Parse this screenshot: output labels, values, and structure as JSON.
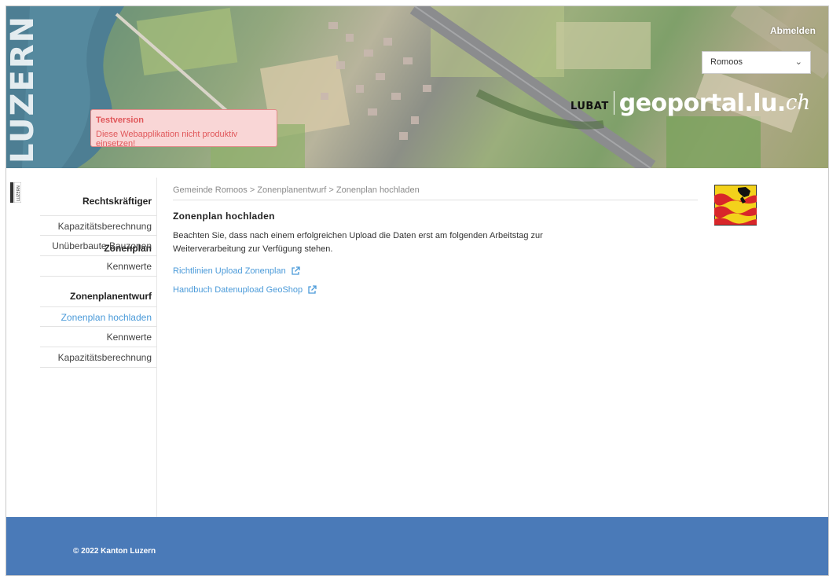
{
  "header": {
    "logo_word": "LUZERN",
    "logout_label": "Abmelden",
    "municipality_select": {
      "value": "Romoos"
    },
    "brand": {
      "prefix": "LUBAT",
      "name": "geoportal.lu.",
      "suffix": "ch"
    },
    "alert": {
      "title": "Testversion",
      "message": "Diese Webapplikation nicht produktiv einsetzen!"
    }
  },
  "sidebar": {
    "sections": [
      {
        "heading": "Rechtskräftiger Zonenplan",
        "items": [
          {
            "label": "Kapazitätsberechnung",
            "active": false
          },
          {
            "label": "Unüberbaute Bauzonen",
            "active": false
          },
          {
            "label": "Kennwerte",
            "active": false
          }
        ]
      },
      {
        "heading": "Zonenplanentwurf",
        "items": [
          {
            "label": "Zonenplan hochladen",
            "active": true
          },
          {
            "label": "Kennwerte",
            "active": false
          },
          {
            "label": "Kapazitätsberechnung",
            "active": false
          }
        ]
      }
    ]
  },
  "main": {
    "breadcrumb": "Gemeinde Romoos > Zonenplanentwurf > Zonenplan hochladen",
    "title": "Zonenplan hochladen",
    "paragraph": "Beachten Sie, dass nach einem erfolgreichen Upload die Daten erst am folgenden Arbeitstag zur Weiterverarbeitung zur Verfügung stehen.",
    "links": [
      {
        "label": "Richtlinien Upload Zonenplan",
        "icon": "external-link-icon"
      },
      {
        "label": "Handbuch Datenupload GeoShop",
        "icon": "external-link-icon"
      }
    ]
  },
  "footer": {
    "copyright": "© 2022 Kanton Luzern"
  },
  "colors": {
    "link": "#4a9ad9",
    "footer": "#4a7ab8",
    "alert_bg": "#f9d6d6",
    "alert_text": "#e0575a"
  }
}
